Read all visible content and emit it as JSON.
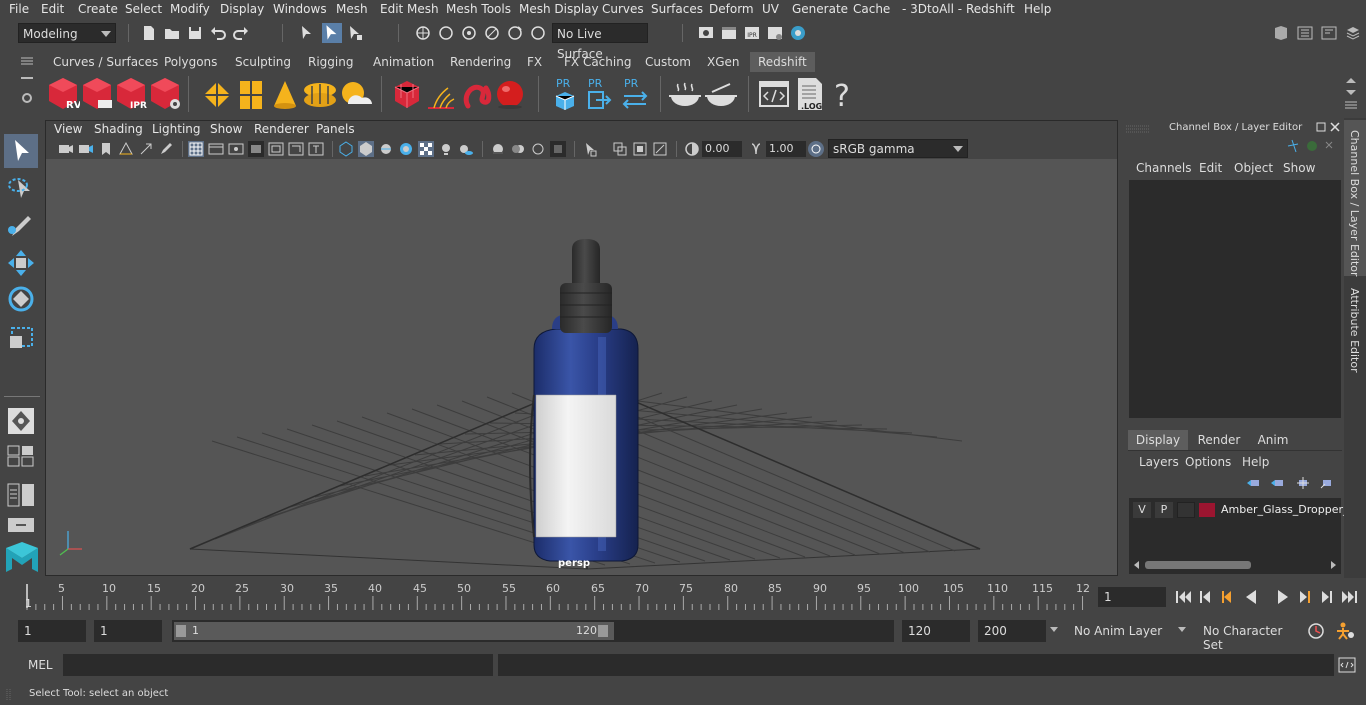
{
  "menu": [
    "File",
    "Edit",
    "Create",
    "Select",
    "Modify",
    "Display",
    "Windows",
    "Mesh",
    "Edit Mesh",
    "Mesh Tools",
    "Mesh Display",
    "Curves",
    "Surfaces",
    "Deform",
    "UV",
    "Generate",
    "Cache",
    "- 3DtoAll -",
    "Redshift",
    "Help"
  ],
  "status": {
    "workspace": "Modeling",
    "live_surface": "No Live Surface"
  },
  "shelf_tabs": [
    "Curves / Surfaces",
    "Polygons",
    "Sculpting",
    "Rigging",
    "Animation",
    "Rendering",
    "FX",
    "FX Caching",
    "Custom",
    "XGen",
    "Redshift"
  ],
  "shelf_active": "Redshift",
  "shelf_icons": {
    "rv": "RV",
    "ipr": "IPR",
    "pr": "PR",
    "log": ".LOG",
    "help": "?"
  },
  "viewport": {
    "menus": [
      "View",
      "Shading",
      "Lighting",
      "Show",
      "Renderer",
      "Panels"
    ],
    "exposure": "0.00",
    "gamma": "1.00",
    "color_space": "sRGB gamma",
    "camera": "persp"
  },
  "channel_box": {
    "title": "Channel Box / Layer Editor",
    "menus": [
      "Channels",
      "Edit",
      "Object",
      "Show"
    ],
    "layer_tabs": [
      "Display",
      "Render",
      "Anim"
    ],
    "layer_active": "Display",
    "layer_menus": [
      "Layers",
      "Options",
      "Help"
    ],
    "layer": {
      "v": "V",
      "p": "P",
      "name": "Amber_Glass_Dropper_",
      "color": "#9b1530"
    }
  },
  "side_tabs": [
    "Channel Box / Layer Editor",
    "Attribute Editor"
  ],
  "timeline": {
    "ticks": [
      "5",
      "10",
      "15",
      "20",
      "25",
      "30",
      "35",
      "40",
      "45",
      "50",
      "55",
      "60",
      "65",
      "70",
      "75",
      "80",
      "85",
      "90",
      "95",
      "100",
      "105",
      "110",
      "115",
      "12"
    ],
    "start_marker": "1",
    "current_frame": "1"
  },
  "range": {
    "start": "1",
    "playback_start": "1",
    "slider_start": "1",
    "slider_end": "120",
    "playback_end": "120",
    "end": "200",
    "anim_layer": "No Anim Layer",
    "character_set": "No Character Set"
  },
  "command": {
    "lang": "MEL"
  },
  "help_line": "Select Tool: select an object"
}
